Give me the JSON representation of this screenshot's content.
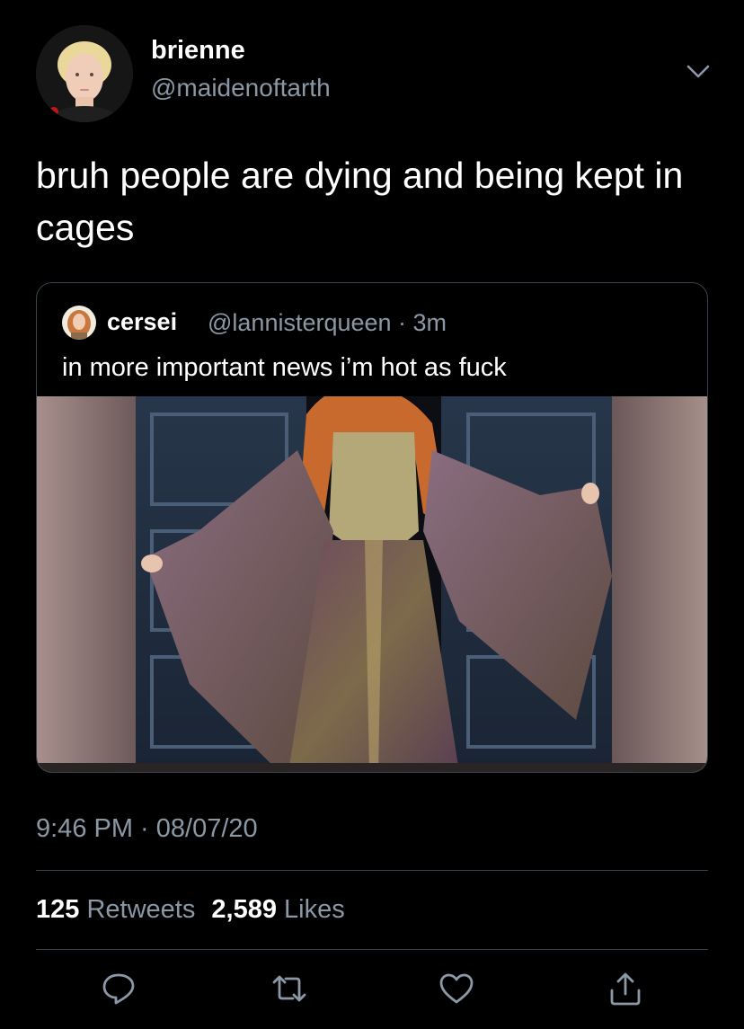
{
  "tweet": {
    "display_name": "brienne",
    "handle": "@maidenoftarth",
    "text": "bruh people are dying and being kept in cages",
    "timestamp": "9:46 PM · 08/07/20"
  },
  "quoted_tweet": {
    "display_name": "cersei",
    "handle": "@lannisterqueen · 3m",
    "text": "in more important news i’m hot as fuck"
  },
  "stats": {
    "retweets_count": "125",
    "retweets_label": "Retweets",
    "likes_count": "2,589",
    "likes_label": "Likes"
  },
  "actions": [
    "reply-icon",
    "retweet-icon",
    "like-icon",
    "share-icon"
  ],
  "colors": {
    "background": "#000000",
    "secondary_text": "#8b98a5",
    "border": "#38444d"
  }
}
